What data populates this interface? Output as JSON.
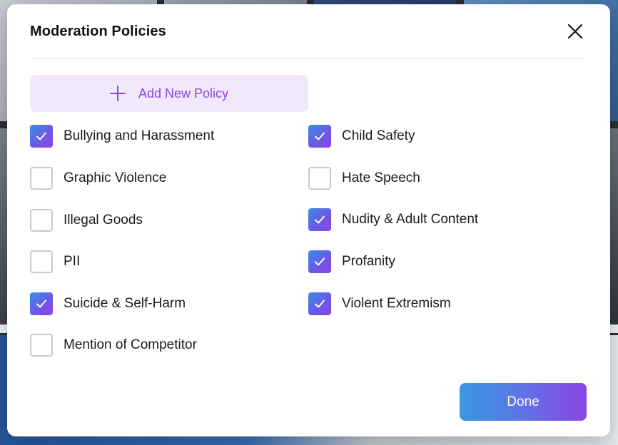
{
  "modal": {
    "title": "Moderation Policies",
    "close_icon": "close-icon",
    "add_policy_label": "Add New Policy",
    "add_policy_icon": "plus-icon",
    "done_label": "Done"
  },
  "colors": {
    "accent_purple": "#8b46e0",
    "add_button_bg": "#f1e9fb",
    "checkbox_gradient_start": "#3a8ee6",
    "checkbox_gradient_end": "#8f43e3",
    "done_gradient_start": "#3a95e4",
    "done_gradient_end": "#8b45e2",
    "unchecked_border": "#c7c9ce"
  },
  "policies": {
    "left": [
      {
        "label": "Bullying and Harassment",
        "checked": true
      },
      {
        "label": "Graphic Violence",
        "checked": false
      },
      {
        "label": "Illegal Goods",
        "checked": false
      },
      {
        "label": "PII",
        "checked": false
      },
      {
        "label": "Suicide & Self-Harm",
        "checked": true
      },
      {
        "label": "Mention of Competitor",
        "checked": false
      }
    ],
    "right": [
      {
        "label": "Child Safety",
        "checked": true
      },
      {
        "label": "Hate Speech",
        "checked": false
      },
      {
        "label": "Nudity & Adult Content",
        "checked": true
      },
      {
        "label": "Profanity",
        "checked": true
      },
      {
        "label": "Violent Extremism",
        "checked": true
      }
    ]
  }
}
